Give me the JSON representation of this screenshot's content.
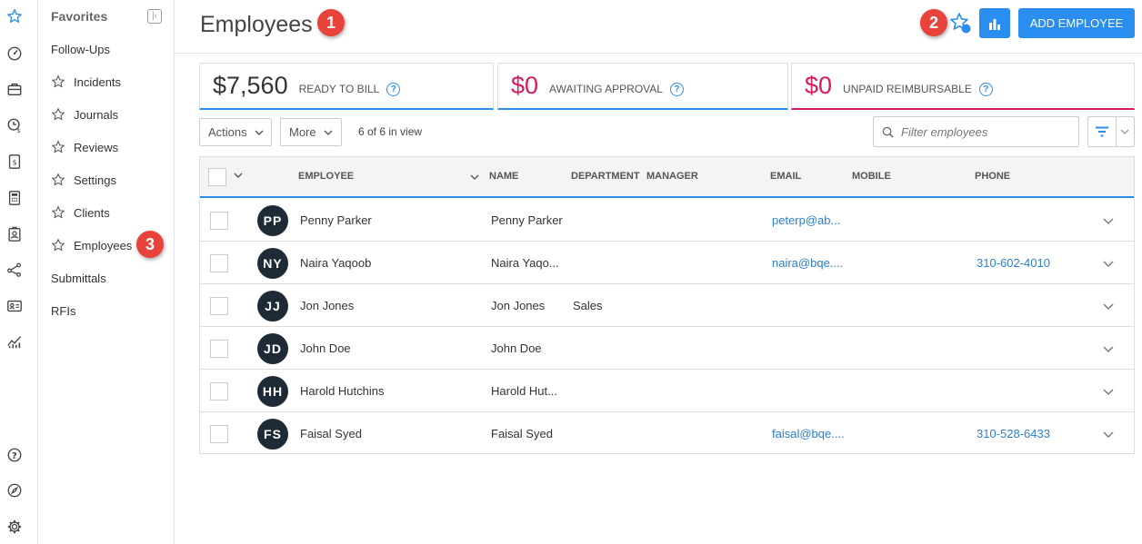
{
  "sidebar": {
    "title": "Favorites",
    "collapse_icon": "collapse-icon",
    "items": [
      {
        "label": "Follow-Ups",
        "starred": false
      },
      {
        "label": "Incidents",
        "starred": true
      },
      {
        "label": "Journals",
        "starred": true
      },
      {
        "label": "Reviews",
        "starred": true
      },
      {
        "label": "Settings",
        "starred": true
      },
      {
        "label": "Clients",
        "starred": true
      },
      {
        "label": "Employees",
        "starred": true
      },
      {
        "label": "Submittals",
        "starred": false
      },
      {
        "label": "RFIs",
        "starred": false
      }
    ]
  },
  "rail_icons": [
    "star-icon",
    "dashboard-icon",
    "briefcase-icon",
    "time-money-icon",
    "invoice-icon",
    "calculator-icon",
    "contact-badge-icon",
    "network-icon",
    "id-card-icon",
    "analytics-icon",
    "help-icon",
    "compass-icon",
    "settings-icon"
  ],
  "header": {
    "title": "Employees",
    "add_button": "ADD EMPLOYEE"
  },
  "annotations": [
    "1",
    "2",
    "3"
  ],
  "summary": [
    {
      "amount": "$7,560",
      "label": "READY TO BILL",
      "color": "#333333",
      "border": "#2a8ef0"
    },
    {
      "amount": "$0",
      "label": "AWAITING APPROVAL",
      "color": "#d81b60",
      "border": "#2a8ef0"
    },
    {
      "amount": "$0",
      "label": "UNPAID REIMBURSABLE",
      "color": "#d81b60",
      "border": "#d81b60"
    }
  ],
  "toolbar": {
    "actions_label": "Actions",
    "more_label": "More",
    "in_view": "6 of 6 in view",
    "filter_placeholder": "Filter employees"
  },
  "table": {
    "columns": [
      "EMPLOYEE",
      "NAME",
      "DEPARTMENT",
      "MANAGER",
      "EMAIL",
      "MOBILE",
      "PHONE"
    ],
    "rows": [
      {
        "initials": "PP",
        "employee": "Penny Parker",
        "name": "Penny Parker",
        "department": "",
        "manager": "",
        "email": "peterp@ab...",
        "mobile": "",
        "phone": ""
      },
      {
        "initials": "NY",
        "employee": "Naira Yaqoob",
        "name": "Naira Yaqo...",
        "department": "",
        "manager": "",
        "email": "naira@bqe....",
        "mobile": "",
        "phone": "310-602-4010"
      },
      {
        "initials": "JJ",
        "employee": "Jon Jones",
        "name": "Jon Jones",
        "department": "Sales",
        "manager": "",
        "email": "",
        "mobile": "",
        "phone": ""
      },
      {
        "initials": "JD",
        "employee": "John Doe",
        "name": "John Doe",
        "department": "",
        "manager": "",
        "email": "",
        "mobile": "",
        "phone": ""
      },
      {
        "initials": "HH",
        "employee": "Harold Hutchins",
        "name": "Harold Hut...",
        "department": "",
        "manager": "",
        "email": "",
        "mobile": "",
        "phone": ""
      },
      {
        "initials": "FS",
        "employee": "Faisal Syed",
        "name": "Faisal Syed",
        "department": "",
        "manager": "",
        "email": "faisal@bqe....",
        "mobile": "",
        "phone": "310-528-6433"
      }
    ]
  },
  "colors": {
    "accent": "#2a8ef0",
    "badge": "#e8423a",
    "negative": "#d81b60",
    "avatar": "#1e2a35"
  }
}
